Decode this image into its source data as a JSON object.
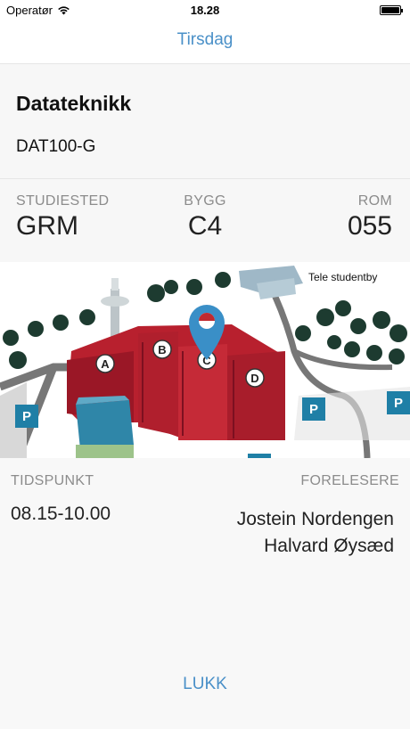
{
  "status_bar": {
    "carrier": "Operatør",
    "time": "18.28"
  },
  "nav": {
    "title": "Tirsdag"
  },
  "course": {
    "name": "Datateknikk",
    "code": "DAT100-G"
  },
  "location": {
    "campus_label": "STUDIESTED",
    "campus": "GRM",
    "building_label": "BYGG",
    "building": "C4",
    "room_label": "ROM",
    "room": "055"
  },
  "map": {
    "place_label": "Tele studentby",
    "buildings": [
      "A",
      "B",
      "C",
      "D"
    ],
    "parking": "P"
  },
  "details": {
    "time_label": "TIDSPUNKT",
    "time": "08.15-10.00",
    "lecturers_label": "FORELESERE",
    "lecturers": [
      "Jostein Nordengen",
      "Halvard Øysæd"
    ]
  },
  "actions": {
    "close_label": "LUKK"
  },
  "colors": {
    "accent": "#4a90c8",
    "building": "#b8202e",
    "parking": "#1f7fa6"
  }
}
